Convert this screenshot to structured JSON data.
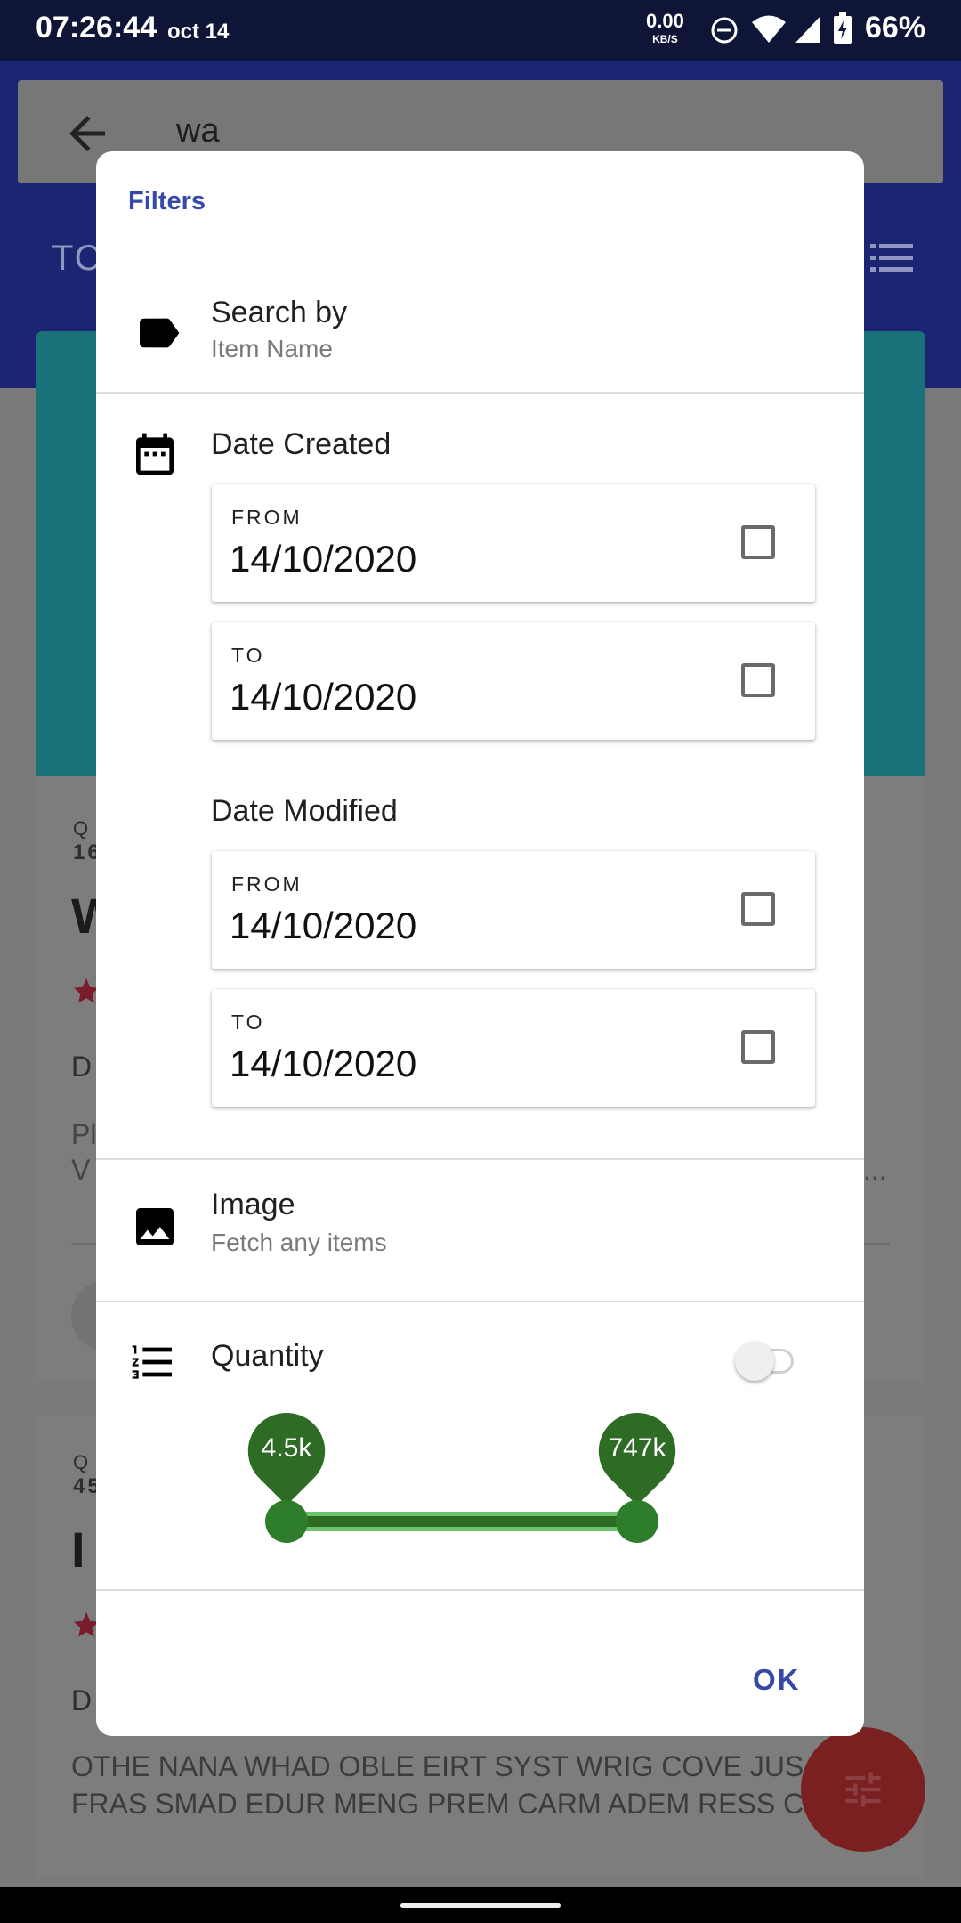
{
  "status_bar": {
    "time": "07:26:44",
    "date": "oct 14",
    "net_speed": "0.00",
    "net_unit": "KB/S",
    "battery": "66%"
  },
  "background": {
    "search_query": "wa",
    "tab_partial": "TO",
    "card1": {
      "label_partial": "Q",
      "count_partial": "16",
      "title_partial": "W",
      "desc_partial": "D",
      "text_partial_1": "Pl",
      "text_partial_2": "V",
      "ellipsis": "..."
    },
    "card2": {
      "label_partial": "Q",
      "count_partial": "45",
      "title_partial": "I",
      "desc_partial": "D",
      "line1": "OTHE NANA WHAD OBLE EIRT SYST WRIG COVE JUS",
      "line2": "FRAS SMAD EDUR MENG PREM CARM ADEM RESS C"
    }
  },
  "dialog": {
    "title": "Filters",
    "search_by": {
      "label": "Search by",
      "value": "Item Name"
    },
    "date_created": {
      "label": "Date Created",
      "from": {
        "label": "FROM",
        "value": "14/10/2020",
        "checked": false
      },
      "to": {
        "label": "TO",
        "value": "14/10/2020",
        "checked": false
      }
    },
    "date_modified": {
      "label": "Date Modified",
      "from": {
        "label": "FROM",
        "value": "14/10/2020",
        "checked": false
      },
      "to": {
        "label": "TO",
        "value": "14/10/2020",
        "checked": false
      }
    },
    "image": {
      "label": "Image",
      "value": "Fetch any items"
    },
    "quantity": {
      "label": "Quantity",
      "enabled": false,
      "min_label": "4.5k",
      "max_label": "747k"
    },
    "ok_label": "OK"
  },
  "colors": {
    "accent": "#3749a8",
    "slider_dark": "#2e6b25",
    "slider_light": "#6cc36f",
    "app_bar": "#1b2572"
  }
}
